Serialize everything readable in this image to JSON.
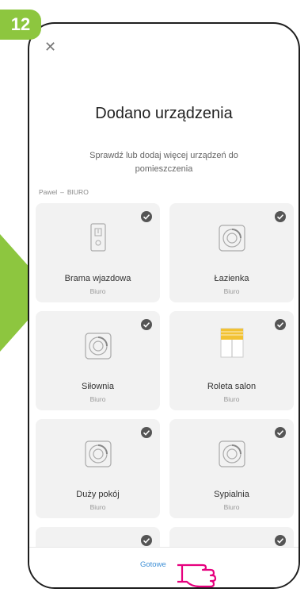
{
  "step": {
    "number": "12",
    "color": "#8dc63f"
  },
  "dialog": {
    "close_icon": "close-icon",
    "title": "Dodano urządzenia",
    "subtitle": "Sprawdź lub dodaj więcej urządzeń do pomieszczenia",
    "owner": "Pawel",
    "owner_separator": "–",
    "room": "BIURO"
  },
  "devices": [
    {
      "name": "Brama wjazdowa",
      "room": "Biuro",
      "icon": "gate-controller-icon",
      "checked": true
    },
    {
      "name": "Łazienka",
      "room": "Biuro",
      "icon": "thermostat-icon",
      "checked": true
    },
    {
      "name": "Siłownia",
      "room": "Biuro",
      "icon": "thermostat-icon",
      "checked": true
    },
    {
      "name": "Roleta salon",
      "room": "Biuro",
      "icon": "roller-blind-icon",
      "checked": true
    },
    {
      "name": "Duży pokój",
      "room": "Biuro",
      "icon": "thermostat-icon",
      "checked": true
    },
    {
      "name": "Sypialnia",
      "room": "Biuro",
      "icon": "thermostat-icon",
      "checked": true
    },
    {
      "name": "",
      "room": "",
      "icon": "thermostat-icon",
      "checked": true
    },
    {
      "name": "",
      "room": "",
      "icon": "switch-icon",
      "checked": true
    }
  ],
  "footer": {
    "done_label": "Gotowe"
  },
  "colors": {
    "accent": "#3d8fd6",
    "card": "#f2f2f2",
    "blind": "#f2c233"
  }
}
